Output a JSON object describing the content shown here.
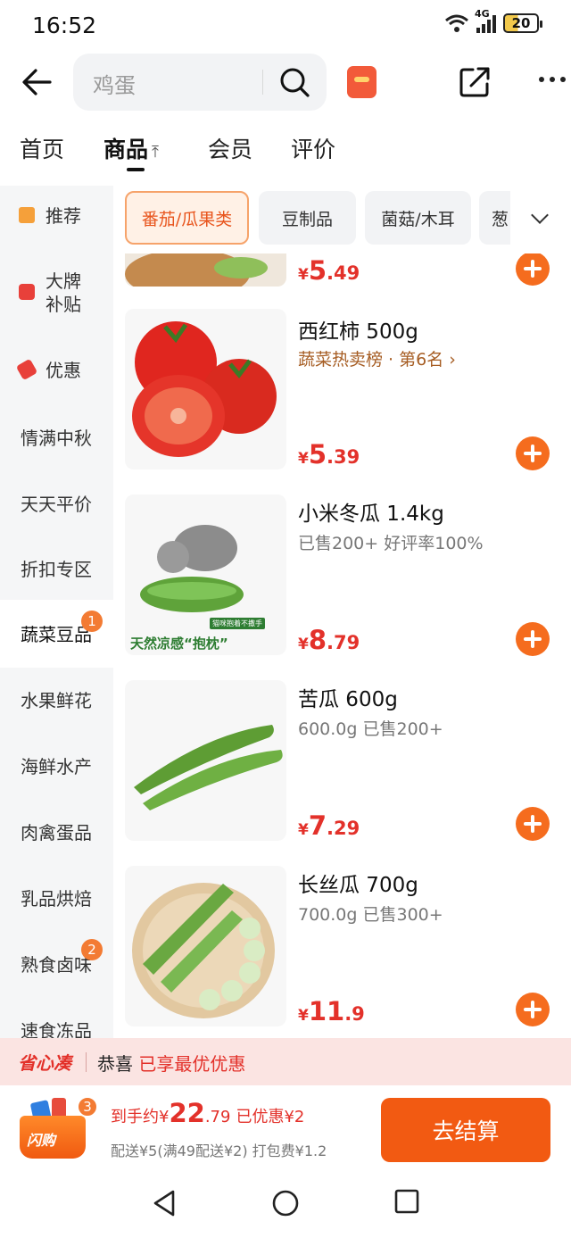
{
  "status_bar": {
    "time": "16:52",
    "network": "4G",
    "battery": "20"
  },
  "search": {
    "placeholder": "鸡蛋"
  },
  "tabs": [
    {
      "label": "首页"
    },
    {
      "label": "商品",
      "arrow": "⤒"
    },
    {
      "label": "会员"
    },
    {
      "label": "评价"
    }
  ],
  "sidebar": {
    "items": [
      {
        "label": "推荐"
      },
      {
        "label": "大牌补贴"
      },
      {
        "label": "优惠"
      },
      {
        "label": "情满中秋"
      },
      {
        "label": "天天平价"
      },
      {
        "label": "折扣专区"
      },
      {
        "label": "蔬菜豆品",
        "badge": "1"
      },
      {
        "label": "水果鲜花"
      },
      {
        "label": "海鲜水产"
      },
      {
        "label": "肉禽蛋品"
      },
      {
        "label": "乳品烘焙"
      },
      {
        "label": "熟食卤味",
        "badge": "2"
      },
      {
        "label": "速食冻品"
      }
    ]
  },
  "chips": [
    {
      "label": "番茄/瓜果类"
    },
    {
      "label": "豆制品"
    },
    {
      "label": "菌菇/木耳"
    },
    {
      "label": "葱"
    }
  ],
  "products": [
    {
      "price_yen": "¥",
      "price_int": "5",
      "price_dec": ".49"
    },
    {
      "name": "西红柿 500g",
      "meta": "蔬菜热卖榜 · 第6名 ›",
      "price_yen": "¥",
      "price_int": "5",
      "price_dec": ".39"
    },
    {
      "name": "小米冬瓜 1.4kg",
      "meta": "已售200+   好评率100%",
      "image_caption": "天然凉感“抱枕”",
      "image_tag": "猫咪抱着不撒手",
      "price_yen": "¥",
      "price_int": "8",
      "price_dec": ".79"
    },
    {
      "name": "苦瓜 600g",
      "meta": "600.0g   已售200+",
      "price_yen": "¥",
      "price_int": "7",
      "price_dec": ".29"
    },
    {
      "name": "长丝瓜 700g",
      "meta": "700.0g   已售300+",
      "price_yen": "¥",
      "price_int": "11",
      "price_dec": ".9"
    }
  ],
  "promo": {
    "brand": "省心凑",
    "msg_prefix": "恭喜 ",
    "msg_highlight": "已享最优优惠"
  },
  "checkout": {
    "cart_label": "闪购",
    "cart_count": "3",
    "total_label": "到手约¥",
    "total_int": "22",
    "total_dec": ".79",
    "discount": "已优惠¥2",
    "fees": "配送¥5(满49配送¥2)   打包费¥1.2",
    "pay_button": "去结算"
  },
  "icons": [
    "back-arrow-icon",
    "search-icon",
    "red-packet-icon",
    "share-icon",
    "more-icon"
  ],
  "colors": {
    "accent": "#f25a12",
    "price": "#e3312a",
    "badge": "#f37b33"
  }
}
